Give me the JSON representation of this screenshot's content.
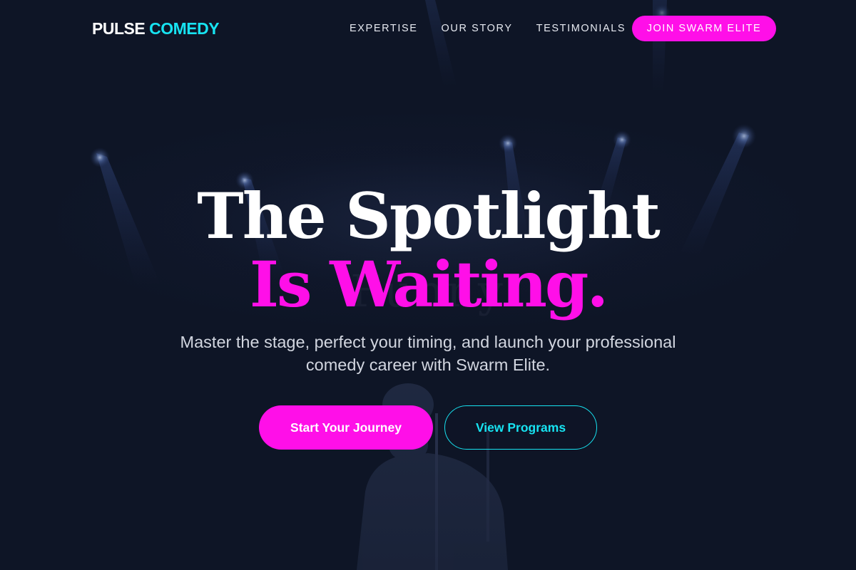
{
  "brand": {
    "name_part1": "PULSE",
    "name_part2": "COMEDY"
  },
  "nav": {
    "links": [
      {
        "label": "EXPERTISE"
      },
      {
        "label": "OUR STORY"
      },
      {
        "label": "TESTIMONIALS"
      }
    ],
    "cta_label": "JOIN SWARM ELITE"
  },
  "hero": {
    "title_line1": "The Spotlight",
    "title_line2": "Is Waiting.",
    "subtitle": "Master the stage, perfect your timing, and launch your professional comedy career with Swarm Elite.",
    "primary_button": "Start Your Journey",
    "secondary_button": "View Programs"
  },
  "background": {
    "image_subject": "stage spotlights with a comedian at a microphone stand"
  },
  "colors": {
    "background": "#0e1526",
    "accent_magenta": "#ff0fe8",
    "accent_cyan": "#17e3f1",
    "text_primary": "#ffffff",
    "text_secondary": "#d2d6e0"
  }
}
